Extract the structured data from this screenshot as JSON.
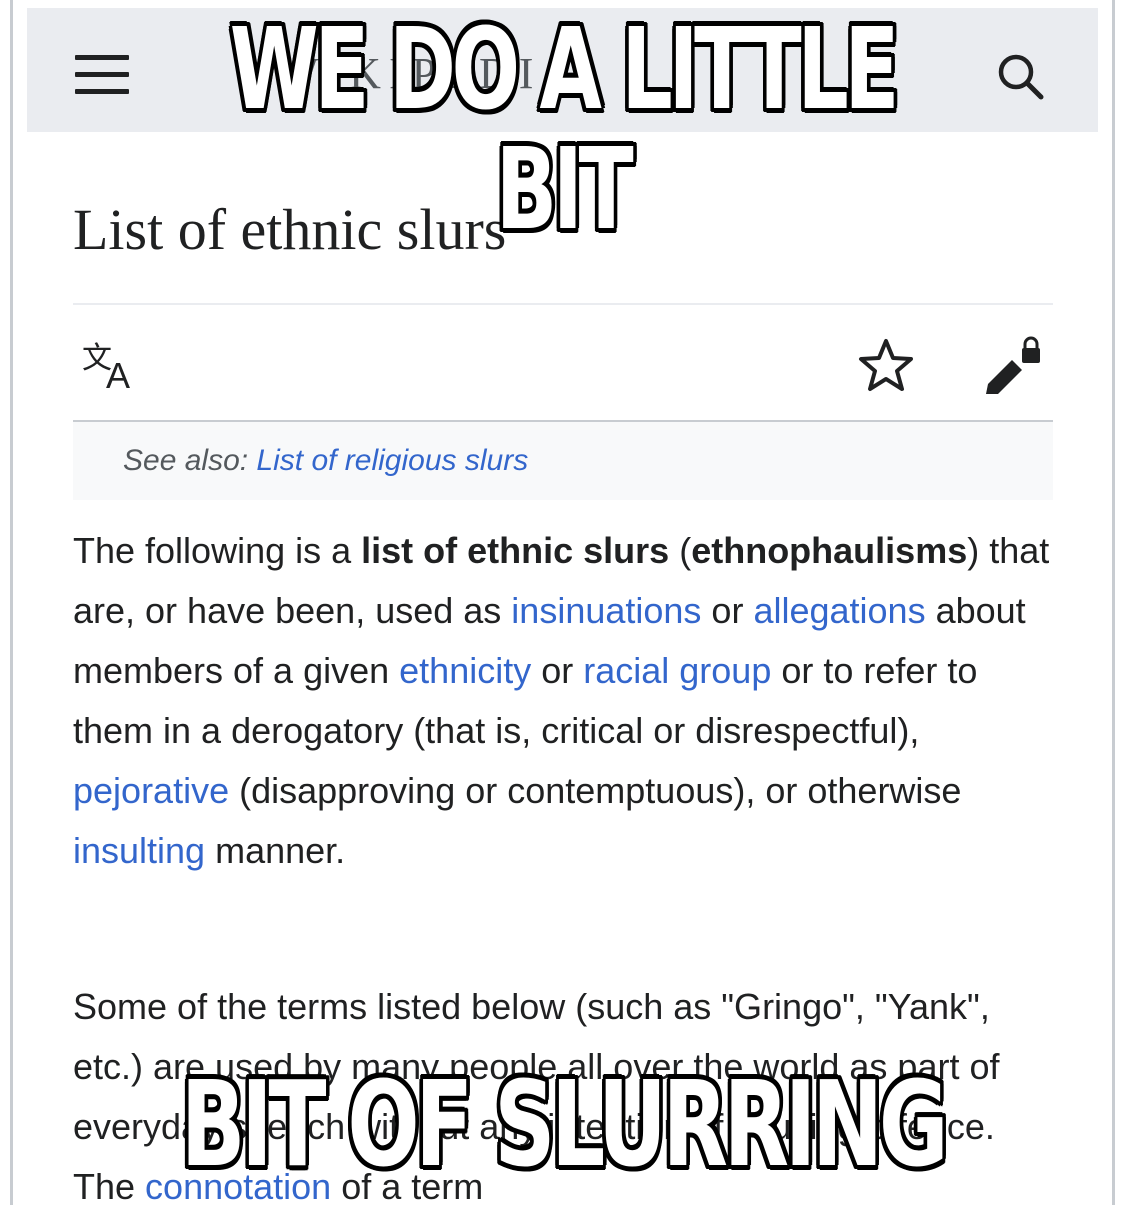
{
  "meme": {
    "top_caption": "WE DO A LITTLE BIT",
    "bottom_caption": "BIT OF SLURRING"
  },
  "header": {
    "logo_text": "WIKIPEDIA",
    "icons": [
      "menu-icon",
      "search-icon"
    ]
  },
  "article": {
    "title": "List of ethnic slurs",
    "actions": [
      "language-icon",
      "watch-star-icon",
      "edit-lock-icon"
    ],
    "hatnote": {
      "prefix": "See also: ",
      "link": "List of religious slurs"
    },
    "paragraph1": {
      "t1": "The following is a ",
      "b1": "list of ethnic slurs",
      "t2": " (",
      "b2": "ethnophaulisms",
      "t3": ") that are, or have been, used as ",
      "l1": "insinuations",
      "t4": " or ",
      "l2": "allegations",
      "t5": " about members of a given ",
      "l3": "ethnicity",
      "t6": " or ",
      "l4": "racial group",
      "t7": " or to refer to them in a derogatory (that is, critical or disrespectful), ",
      "l5": "pejorative",
      "t8": " (disapproving or contemptuous), or otherwise ",
      "l6": "insulting",
      "t9": " manner."
    },
    "paragraph2": {
      "t1": "Some of the terms listed below (such as \"Gringo\", \"Yank\", etc.) are used by many people all over the world as part of everyday speech without any intention of causing offence. The ",
      "l1": "connotation",
      "t2": " of a term"
    }
  },
  "colors": {
    "link": "#3366cc",
    "text": "#202122",
    "header_bg": "#eaecf0",
    "hatnote_bg": "#f8f9fa"
  }
}
